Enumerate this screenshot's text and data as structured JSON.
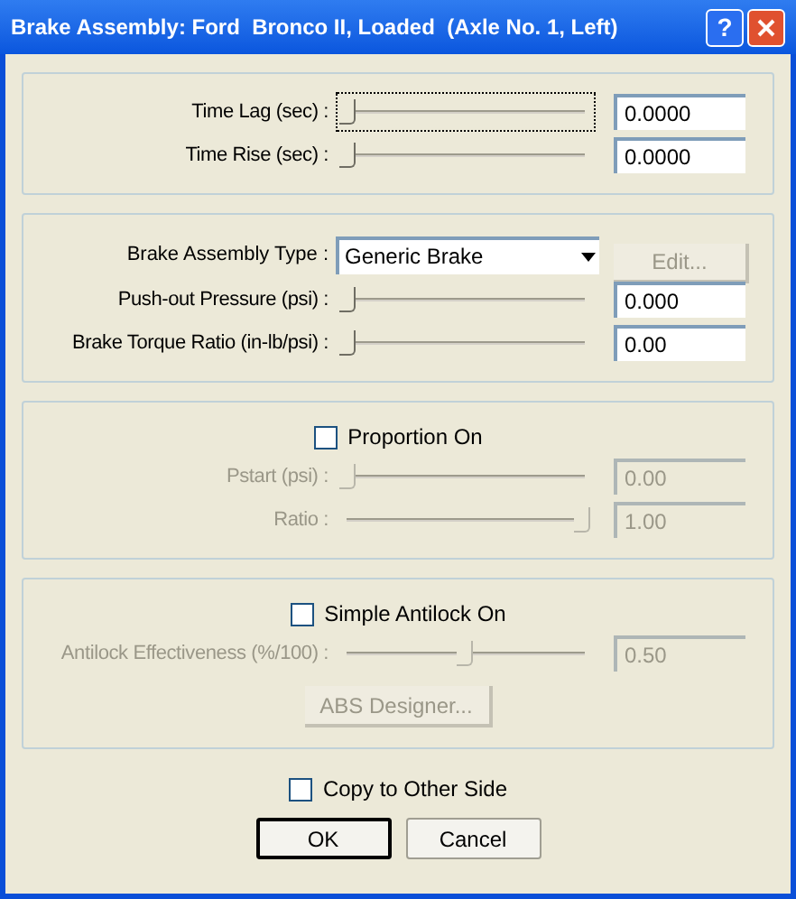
{
  "window": {
    "title": "Brake Assembly: Ford  Bronco II, Loaded  (Axle No. 1, Left)",
    "help_button": "?"
  },
  "groups": [
    {
      "rows": [
        {
          "kind": "slider",
          "label": "Time Lag (sec) :",
          "level": 0,
          "value": "0.0000",
          "disabled": false,
          "focused": true
        },
        {
          "kind": "slider",
          "label": "Time Rise (sec) :",
          "level": 0,
          "value": "0.0000",
          "disabled": false,
          "focused": false
        }
      ]
    },
    {
      "rows": [
        {
          "kind": "dropdown",
          "label": "Brake Assembly Type :",
          "value": "Generic Brake",
          "button": "Edit...",
          "button_disabled": true
        },
        {
          "kind": "slider",
          "label": "Push-out Pressure (psi) :",
          "level": 0,
          "value": "0.000",
          "disabled": false,
          "focused": false
        },
        {
          "kind": "slider",
          "label": "Brake Torque Ratio (in-lb/psi) :",
          "level": 0,
          "value": "0.00",
          "disabled": false,
          "focused": false
        }
      ]
    },
    {
      "rows": [
        {
          "kind": "checkbox",
          "label": "Proportion On",
          "checked": false
        },
        {
          "kind": "slider",
          "label": "Pstart (psi) :",
          "level": 0,
          "value": "0.00",
          "disabled": true,
          "focused": false
        },
        {
          "kind": "slider",
          "label": "Ratio :",
          "level": 1,
          "value": "1.00",
          "disabled": true,
          "focused": false
        }
      ]
    },
    {
      "rows": [
        {
          "kind": "checkbox",
          "label": "Simple Antilock On",
          "checked": false
        },
        {
          "kind": "slider",
          "label": "Antilock Effectiveness (%/100) :",
          "level": 0.5,
          "value": "0.50",
          "disabled": true,
          "focused": false
        },
        {
          "kind": "button",
          "label": "ABS Designer...",
          "disabled": true
        }
      ]
    }
  ],
  "copy_checkbox": {
    "label": "Copy to Other Side",
    "checked": false
  },
  "buttons": [
    {
      "label": "OK",
      "default": true
    },
    {
      "label": "Cancel",
      "default": false
    }
  ]
}
